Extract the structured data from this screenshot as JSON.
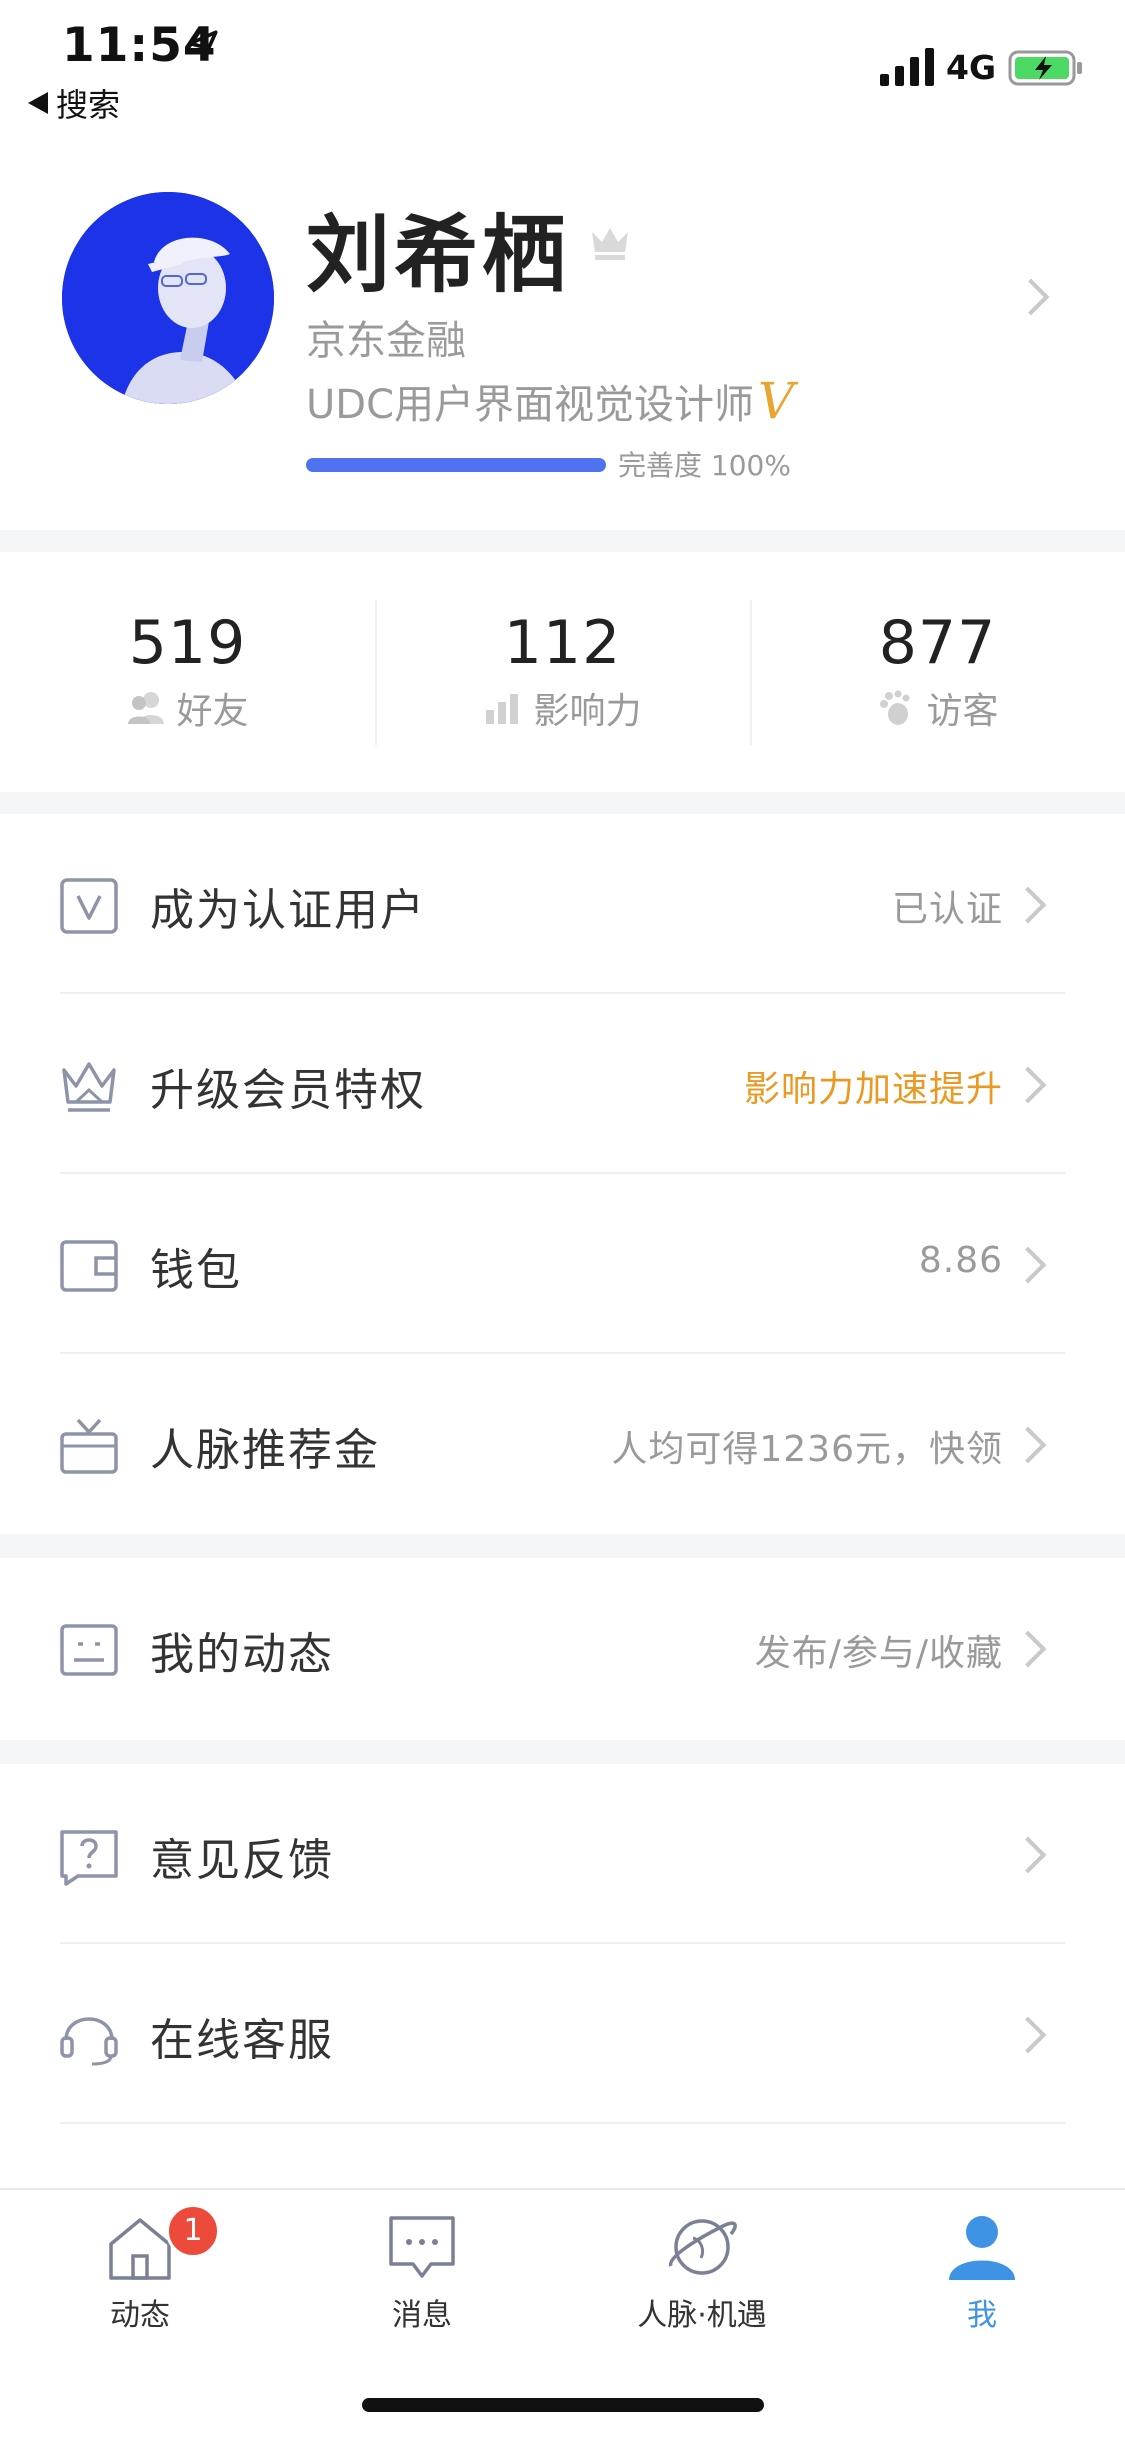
{
  "status_bar": {
    "time": "11:54",
    "back_label": "搜索",
    "network": "4G"
  },
  "profile": {
    "name": "刘希栖",
    "company": "京东金融",
    "title": "UDC用户界面视觉设计师",
    "title_badge": "V",
    "completeness_label": "完善度 100%",
    "completeness": 1.0
  },
  "stats": [
    {
      "value": "519",
      "label": "好友",
      "icon": "friends-icon"
    },
    {
      "value": "112",
      "label": "影响力",
      "icon": "influence-icon"
    },
    {
      "value": "877",
      "label": "访客",
      "icon": "footprint-icon"
    }
  ],
  "menu_group_1": [
    {
      "label": "成为认证用户",
      "right": "已认证",
      "icon": "verified-v-icon"
    },
    {
      "label": "升级会员特权",
      "right": "影响力加速提升",
      "icon": "crown-icon",
      "right_color": "#ea9a23"
    },
    {
      "label": "钱包",
      "right": "8.86",
      "icon": "wallet-icon"
    },
    {
      "label": "人脉推荐金",
      "right": "人均可得1236元，快领",
      "icon": "gift-tv-icon"
    }
  ],
  "menu_group_2": [
    {
      "label": "我的动态",
      "right": "发布/参与/收藏",
      "icon": "feed-card-icon"
    }
  ],
  "menu_group_3": [
    {
      "label": "意见反馈",
      "right": "",
      "icon": "feedback-question-icon"
    },
    {
      "label": "在线客服",
      "right": "",
      "icon": "headset-icon"
    }
  ],
  "tabbar": {
    "tabs": [
      {
        "label": "动态",
        "icon": "home-icon",
        "badge": "1"
      },
      {
        "label": "消息",
        "icon": "message-icon"
      },
      {
        "label": "人脉·机遇",
        "icon": "planet-icon"
      },
      {
        "label": "我",
        "icon": "person-icon",
        "active": true
      }
    ]
  },
  "colors": {
    "accent_blue": "#4f73f0",
    "tab_active": "#3f93e4",
    "orange": "#ea9a23",
    "badge_red": "#ec4a3b"
  }
}
